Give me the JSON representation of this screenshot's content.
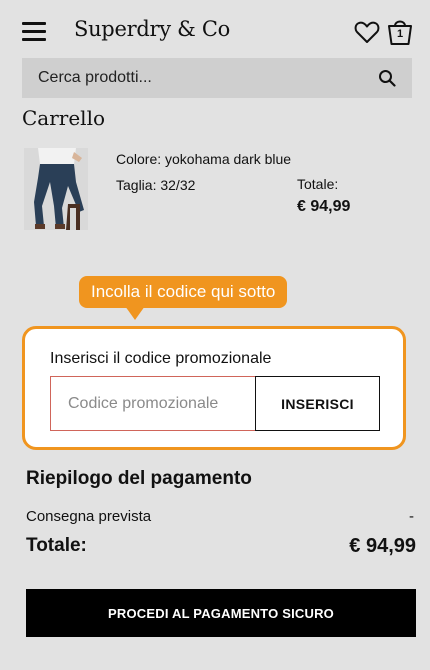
{
  "header": {
    "brand": "Superdry & Co",
    "bag_count": "1"
  },
  "search": {
    "placeholder": "Cerca prodotti..."
  },
  "cart": {
    "title": "Carrello",
    "item": {
      "color": "Colore: yokohama dark blue",
      "size": "Taglia: 32/32",
      "total_label": "Totale:",
      "total": "€ 94,99"
    }
  },
  "promo": {
    "tooltip": "Incolla il codice qui sotto",
    "label": "Inserisci il codice promozionale",
    "placeholder": "Codice promozionale",
    "button": "INSERISCI"
  },
  "summary": {
    "title": "Riepilogo del pagamento",
    "delivery_label": "Consegna prevista",
    "delivery_value": "-",
    "total_label": "Totale:",
    "total_value": "€ 94,99"
  },
  "checkout": {
    "button": "PROCEDI AL PAGAMENTO SICURO"
  },
  "colors": {
    "background": "#e2e2e2",
    "accent": "#f0951f",
    "button": "#000000"
  }
}
